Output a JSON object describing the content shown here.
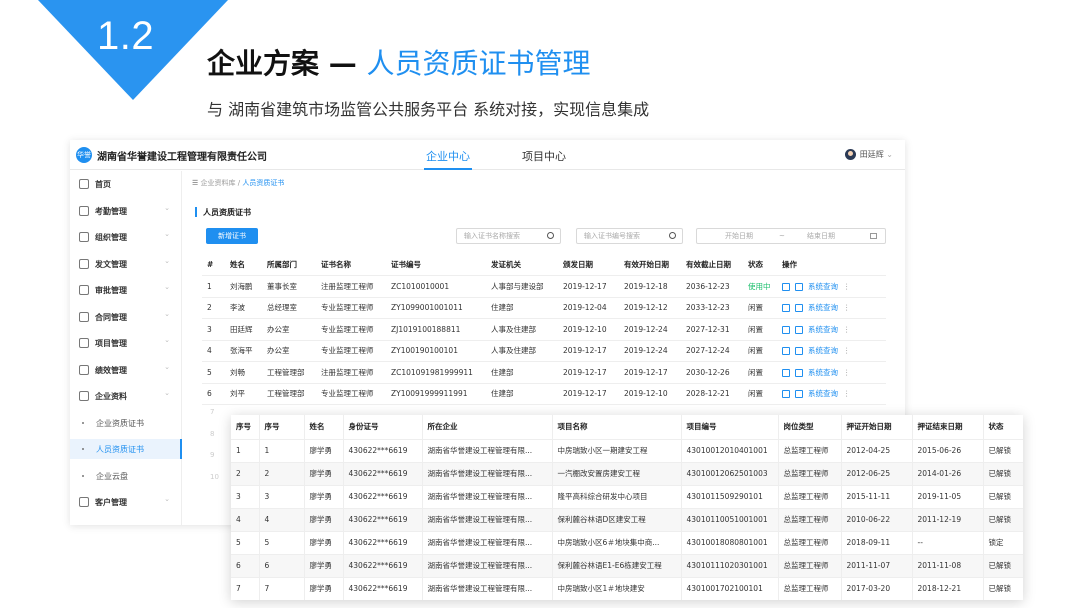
{
  "slide": {
    "number": "1.2",
    "title_main": "企业方案 — ",
    "title_highlight": "人员资质证书管理",
    "subtitle": "与 湖南省建筑市场监管公共服务平台 系统对接，实现信息集成"
  },
  "app": {
    "logo_text": "华誉",
    "company": "湖南省华誉建设工程管理有限责任公司",
    "nav": [
      "企业中心",
      "项目中心"
    ],
    "user": "田廷辉",
    "sidebar": [
      {
        "label": "首页",
        "icon": "home-icon"
      },
      {
        "label": "考勤管理",
        "icon": "check-icon"
      },
      {
        "label": "组织管理",
        "icon": "org-icon"
      },
      {
        "label": "发文管理",
        "icon": "doc-icon"
      },
      {
        "label": "审批管理",
        "icon": "approve-icon"
      },
      {
        "label": "合同管理",
        "icon": "contract-icon"
      },
      {
        "label": "项目管理",
        "icon": "project-icon"
      },
      {
        "label": "绩效管理",
        "icon": "kpi-icon"
      },
      {
        "label": "企业资料",
        "icon": "folder-icon"
      },
      {
        "label": "企业资质证书",
        "sub": true
      },
      {
        "label": "人员资质证书",
        "sub": true,
        "active": true
      },
      {
        "label": "企业云盘",
        "sub": true
      },
      {
        "label": "客户管理",
        "icon": "customer-icon"
      }
    ],
    "breadcrumb": {
      "root": "企业资料库",
      "sep": " / ",
      "current": "人员资质证书"
    },
    "section_title": "人员资质证书",
    "new_button": "新增证书",
    "search1_placeholder": "输入证书名称搜索",
    "search2_placeholder": "输入证书编号搜索",
    "date_start": "开始日期",
    "date_sep": "~",
    "date_end": "结束日期",
    "table": {
      "headers": [
        "#",
        "姓名",
        "所属部门",
        "证书名称",
        "证书编号",
        "发证机关",
        "颁发日期",
        "有效开始日期",
        "有效截止日期",
        "状态",
        "操作"
      ],
      "rows": [
        [
          "1",
          "刘海鹏",
          "董事长室",
          "注册监理工程师",
          "ZC1010010001",
          "人事部与建设部",
          "2019-12-17",
          "2019-12-18",
          "2036-12-23",
          "使用中"
        ],
        [
          "2",
          "李波",
          "总经理室",
          "专业监理工程师",
          "ZY1099001001011",
          "住建部",
          "2019-12-04",
          "2019-12-12",
          "2033-12-23",
          "闲置"
        ],
        [
          "3",
          "田廷辉",
          "办公室",
          "专业监理工程师",
          "ZJ1019100188811",
          "人事及住建部",
          "2019-12-10",
          "2019-12-24",
          "2027-12-31",
          "闲置"
        ],
        [
          "4",
          "张海平",
          "办公室",
          "专业监理工程师",
          "ZY100190100101",
          "人事及住建部",
          "2019-12-17",
          "2019-12-24",
          "2027-12-24",
          "闲置"
        ],
        [
          "5",
          "刘畅",
          "工程管理部",
          "注册监理工程师",
          "ZC101091981999911",
          "住建部",
          "2019-12-17",
          "2019-12-17",
          "2030-12-26",
          "闲置"
        ],
        [
          "6",
          "刘平",
          "工程管理部",
          "专业监理工程师",
          "ZY10091999911991",
          "住建部",
          "2019-12-17",
          "2019-12-10",
          "2028-12-21",
          "闲置"
        ]
      ],
      "op_link": "系统查询",
      "more": "⋮",
      "faded_rows": [
        "7",
        "8",
        "9",
        "10"
      ]
    }
  },
  "overlay": {
    "headers": [
      "序号",
      "序号",
      "姓名",
      "身份证号",
      "所在企业",
      "项目名称",
      "项目编号",
      "岗位类型",
      "押证开始日期",
      "押证结束日期",
      "状态"
    ],
    "rows": [
      [
        "1",
        "1",
        "廖学勇",
        "430622***6619",
        "湖南省华誉建设工程管理有限...",
        "中房瑞致小区一期建安工程",
        "43010012010401001",
        "总监理工程师",
        "2012-04-25",
        "2015-06-26",
        "已解锁"
      ],
      [
        "2",
        "2",
        "廖学勇",
        "430622***6619",
        "湖南省华誉建设工程管理有限...",
        "一汽棚改安置房建安工程",
        "43010012062501003",
        "总监理工程师",
        "2012-06-25",
        "2014-01-26",
        "已解锁"
      ],
      [
        "3",
        "3",
        "廖学勇",
        "430622***6619",
        "湖南省华誉建设工程管理有限...",
        "隆平高科综合研发中心项目",
        "4301011509290101",
        "总监理工程师",
        "2015-11-11",
        "2019-11-05",
        "已解锁"
      ],
      [
        "4",
        "4",
        "廖学勇",
        "430622***6619",
        "湖南省华誉建设工程管理有限...",
        "保利麓谷林语D区建安工程",
        "43010110051001001",
        "总监理工程师",
        "2010-06-22",
        "2011-12-19",
        "已解锁"
      ],
      [
        "5",
        "5",
        "廖学勇",
        "430622***6619",
        "湖南省华誉建设工程管理有限...",
        "中房瑞致小区6＃地块集中商...",
        "43010018080801001",
        "总监理工程师",
        "2018-09-11",
        "--",
        "锁定"
      ],
      [
        "6",
        "6",
        "廖学勇",
        "430622***6619",
        "湖南省华誉建设工程管理有限...",
        "保利麓谷林语E1-E6栋建安工程",
        "43010111020301001",
        "总监理工程师",
        "2011-11-07",
        "2011-11-08",
        "已解锁"
      ],
      [
        "7",
        "7",
        "廖学勇",
        "430622***6619",
        "湖南省华誉建设工程管理有限...",
        "中房瑞致小区1＃地块建安",
        "4301001702100101",
        "总监理工程师",
        "2017-03-20",
        "2018-12-21",
        "已解锁"
      ]
    ]
  },
  "colors": {
    "accent": "#1f8ff0",
    "corner": "#2a94f0",
    "ok": "#19be6b"
  }
}
